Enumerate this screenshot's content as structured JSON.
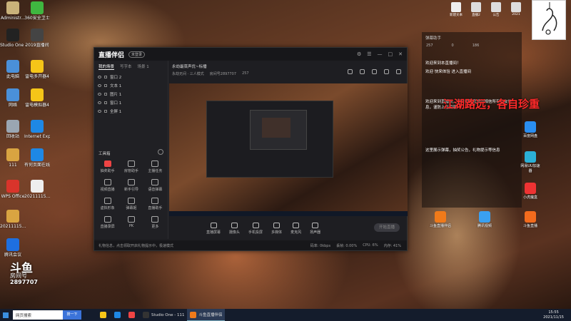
{
  "desktop": {
    "icons": [
      {
        "label": "Administr...",
        "color": "#c9b27a"
      },
      {
        "label": "360安全卫士",
        "color": "#3fb640"
      },
      {
        "label": "Studio One 4",
        "color": "#222"
      },
      {
        "label": "2019直播间",
        "color": "#444"
      },
      {
        "label": "此电脑",
        "color": "#4a90d9"
      },
      {
        "label": "雷电多开器4",
        "color": "#f5c518"
      },
      {
        "label": "网络",
        "color": "#4a90d9"
      },
      {
        "label": "雷电模拟器4",
        "color": "#f5c518"
      },
      {
        "label": "回收站",
        "color": "#9aa6b2"
      },
      {
        "label": "Internet Explorer",
        "color": "#1e88e5"
      },
      {
        "label": "111",
        "color": "#d9a441"
      },
      {
        "label": "有何页面在线",
        "color": "#1e88e5"
      },
      {
        "label": "WPS Office",
        "color": "#d9342b"
      },
      {
        "label": "20211115...",
        "color": "#eee"
      },
      {
        "label": "20211115...",
        "color": "#d9a441"
      },
      {
        "label": "腾讯会议",
        "color": "#1e6fe0"
      }
    ],
    "right_icons": [
      {
        "label": "百度网盘",
        "color": "#2a8ef0"
      },
      {
        "label": "网易UU加速器",
        "color": "#2bb0d6"
      },
      {
        "label": "小虎魔盒",
        "color": "#e33"
      },
      {
        "label": "斗鱼直播伴侣",
        "color": "#f07a1a"
      },
      {
        "label": "腾讯视频",
        "color": "#3aa0f0"
      },
      {
        "label": "斗鱼直播",
        "color": "#f26b1d"
      }
    ],
    "top_tray": [
      {
        "label": "新建文本",
        "color": "#eee"
      },
      {
        "label": "直播2",
        "color": "#ddd"
      },
      {
        "label": "公告",
        "color": "#ddd"
      },
      {
        "label": "2021",
        "color": "#ddd"
      }
    ]
  },
  "app": {
    "logo": "直播伴侣",
    "badge": "未登录",
    "scene_tabs": [
      "我的场景",
      "写字本",
      "场景 1"
    ],
    "layers": [
      "窗口 2",
      "文本 1",
      "图片 1",
      "窗口 1",
      "全屏 1"
    ],
    "tools_title": "工具箱",
    "tools": [
      {
        "label": "抽奖助手",
        "red": true
      },
      {
        "label": "房管助手",
        "red": false
      },
      {
        "label": "主播任务",
        "red": false
      },
      {
        "label": "视频直播",
        "red": false
      },
      {
        "label": "新手引导",
        "red": false
      },
      {
        "label": "语音弹幕",
        "red": false
      },
      {
        "label": "虚拟形象",
        "red": false
      },
      {
        "label": "弹幕姬",
        "red": false
      },
      {
        "label": "直播助手",
        "red": false
      },
      {
        "label": "直播录屏",
        "red": false
      },
      {
        "label": "PK",
        "red": false
      },
      {
        "label": "更多",
        "red": false
      }
    ],
    "preview_title": "永劫最菜声优~标播",
    "preview_sub": [
      "永劫无间 · 三人模式",
      "房间号2897707",
      "257"
    ],
    "bottom_tools": [
      "直播屏幕",
      "摄像头",
      "手机投屏",
      "多媒体",
      "麦克风",
      "扬声器"
    ],
    "start_button": "开始直播",
    "status_text": "礼物信息，点击领取开启礼物提示中，极速模式",
    "status_right": [
      "码率: 0kbps",
      "丢帧: 0.00%",
      "CPU: 6%",
      "内存: 41%"
    ]
  },
  "chat": {
    "header": "弹幕助手",
    "stats": [
      "257",
      "0",
      "186"
    ],
    "messages": [
      "欢迎来到本直播间！",
      "欢迎 快来体验 进入直播间",
      "欢迎来到直播间，官方提醒您请勿相信所有交友信息，谨防上当受骗",
      "这里展示弹幕，抽奖公告，礼物提示等信息"
    ],
    "big_banner": "江湖路远，各自珍重"
  },
  "watermark": {
    "logo": "斗鱼",
    "sub": "房间号",
    "number": "2897707"
  },
  "taskbar": {
    "search_placeholder": "网页搜索",
    "search_button": "搜一下",
    "apps": [
      {
        "label": "",
        "color": "#f5c518"
      },
      {
        "label": "",
        "color": "#1e88e5"
      },
      {
        "label": "",
        "color": "#e44"
      },
      {
        "label": "Studio One - 111",
        "color": "#333"
      },
      {
        "label": "斗鱼直播伴侣",
        "color": "#f07a1a"
      }
    ],
    "time": "15:55",
    "date": "2021/11/15"
  }
}
